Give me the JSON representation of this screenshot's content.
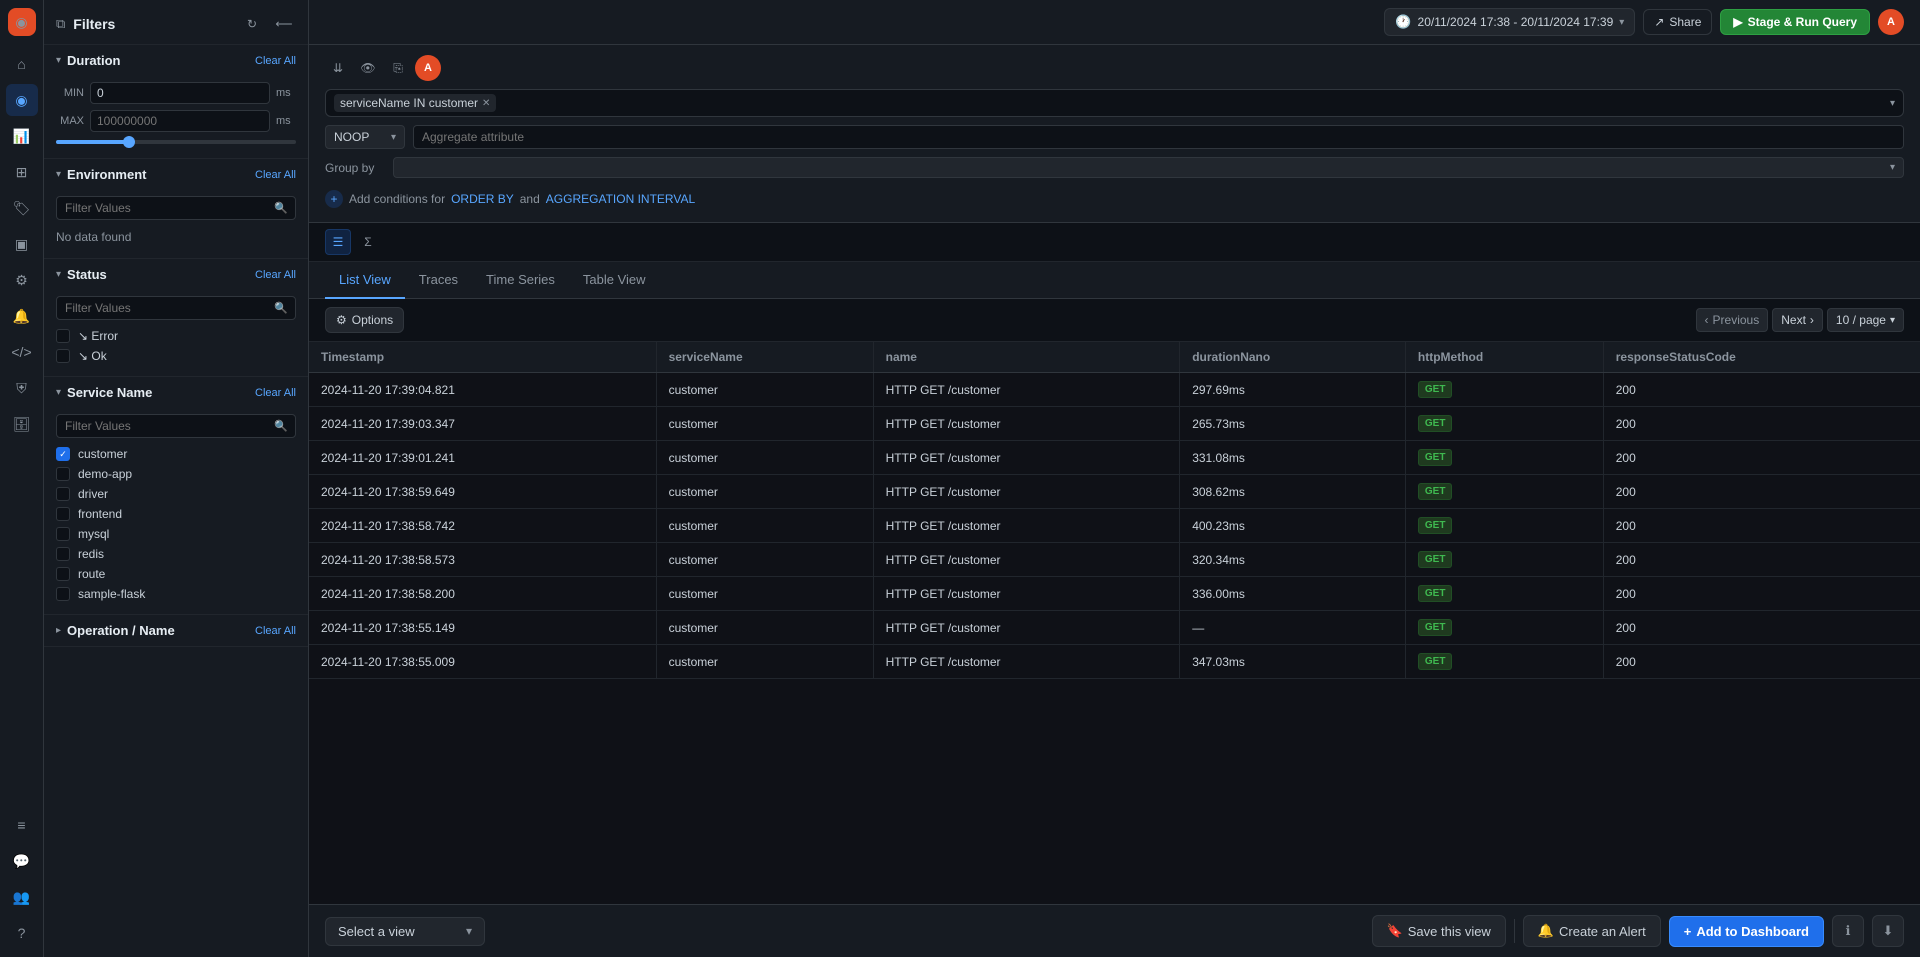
{
  "brand": {
    "icon": "◉",
    "initial": "A"
  },
  "nav": {
    "items": [
      {
        "name": "home",
        "icon": "⌂",
        "active": false
      },
      {
        "name": "activity",
        "icon": "◎",
        "active": false
      },
      {
        "name": "bar-chart",
        "icon": "▦",
        "active": false
      },
      {
        "name": "layers",
        "icon": "⊞",
        "active": false
      },
      {
        "name": "tag",
        "icon": "⊕",
        "active": false
      },
      {
        "name": "grid",
        "icon": "▣",
        "active": false
      },
      {
        "name": "settings-gear",
        "icon": "⚙",
        "active": false
      },
      {
        "name": "bell",
        "icon": "🔔",
        "active": false
      },
      {
        "name": "code",
        "icon": "⟨⟩",
        "active": false
      },
      {
        "name": "shield",
        "icon": "⛨",
        "active": false
      },
      {
        "name": "database",
        "icon": "▦",
        "active": false
      },
      {
        "name": "sliders",
        "icon": "≡",
        "active": false
      },
      {
        "name": "chat",
        "icon": "💬",
        "active": false
      },
      {
        "name": "users",
        "icon": "👥",
        "active": false
      },
      {
        "name": "help",
        "icon": "?",
        "active": false
      }
    ]
  },
  "topbar": {
    "time_range": "20/11/2024 17:38 - 20/11/2024 17:39",
    "share_label": "Share",
    "run_label": "Stage & Run Query",
    "avatar_initial": "A"
  },
  "filters": {
    "title": "Filters",
    "duration": {
      "title": "Duration",
      "clear_label": "Clear All",
      "min_label": "MIN",
      "min_value": "0",
      "min_unit": "ms",
      "max_label": "MAX",
      "max_value": "100000000",
      "max_unit": "ms"
    },
    "environment": {
      "title": "Environment",
      "clear_label": "Clear All",
      "search_placeholder": "Filter Values",
      "no_data": "No data found"
    },
    "status": {
      "title": "Status",
      "clear_label": "Clear All",
      "search_placeholder": "Filter Values",
      "options": [
        {
          "label": "Error",
          "checked": false
        },
        {
          "label": "Ok",
          "checked": false
        }
      ]
    },
    "service_name": {
      "title": "Service Name",
      "clear_label": "Clear All",
      "search_placeholder": "Filter Values",
      "items": [
        {
          "label": "customer",
          "checked": true
        },
        {
          "label": "demo-app",
          "checked": false
        },
        {
          "label": "driver",
          "checked": false
        },
        {
          "label": "frontend",
          "checked": false
        },
        {
          "label": "mysql",
          "checked": false
        },
        {
          "label": "redis",
          "checked": false
        },
        {
          "label": "route",
          "checked": false
        },
        {
          "label": "sample-flask",
          "checked": false
        }
      ]
    },
    "operation_name": {
      "title": "Operation / Name",
      "clear_label": "Clear All"
    }
  },
  "query": {
    "tag_filter": "serviceName IN customer",
    "noop_label": "NOOP",
    "agg_placeholder": "Aggregate attribute",
    "groupby_label": "Group by",
    "conditions_text": "Add conditions for",
    "order_by_label": "ORDER BY",
    "and_label": "and",
    "aggregation_interval_label": "AGGREGATION INTERVAL"
  },
  "toolbar": {
    "buttons": [
      "collapse",
      "eye",
      "copy",
      "A-accent"
    ]
  },
  "tabs": {
    "items": [
      "List View",
      "Traces",
      "Time Series",
      "Table View"
    ],
    "active": "List View"
  },
  "results": {
    "options_label": "Options",
    "previous_label": "Previous",
    "next_label": "Next",
    "page_label": "10 / page",
    "columns": [
      "Timestamp",
      "serviceName",
      "name",
      "durationNano",
      "httpMethod",
      "responseStatusCode"
    ],
    "rows": [
      {
        "timestamp": "2024-11-20 17:39:04.821",
        "serviceName": "customer",
        "name": "HTTP GET /customer",
        "durationNano": "297.69ms",
        "httpMethod": "GET",
        "responseStatusCode": "200"
      },
      {
        "timestamp": "2024-11-20 17:39:03.347",
        "serviceName": "customer",
        "name": "HTTP GET /customer",
        "durationNano": "265.73ms",
        "httpMethod": "GET",
        "responseStatusCode": "200"
      },
      {
        "timestamp": "2024-11-20 17:39:01.241",
        "serviceName": "customer",
        "name": "HTTP GET /customer",
        "durationNano": "331.08ms",
        "httpMethod": "GET",
        "responseStatusCode": "200"
      },
      {
        "timestamp": "2024-11-20 17:38:59.649",
        "serviceName": "customer",
        "name": "HTTP GET /customer",
        "durationNano": "308.62ms",
        "httpMethod": "GET",
        "responseStatusCode": "200"
      },
      {
        "timestamp": "2024-11-20 17:38:58.742",
        "serviceName": "customer",
        "name": "HTTP GET /customer",
        "durationNano": "400.23ms",
        "httpMethod": "GET",
        "responseStatusCode": "200"
      },
      {
        "timestamp": "2024-11-20 17:38:58.573",
        "serviceName": "customer",
        "name": "HTTP GET /customer",
        "durationNano": "320.34ms",
        "httpMethod": "GET",
        "responseStatusCode": "200"
      },
      {
        "timestamp": "2024-11-20 17:38:58.200",
        "serviceName": "customer",
        "name": "HTTP GET /customer",
        "durationNano": "336.00ms",
        "httpMethod": "GET",
        "responseStatusCode": "200"
      },
      {
        "timestamp": "2024-11-20 17:38:55.149",
        "serviceName": "customer",
        "name": "HTTP GET /customer",
        "durationNano": "—",
        "httpMethod": "GET",
        "responseStatusCode": "200"
      },
      {
        "timestamp": "2024-11-20 17:38:55.009",
        "serviceName": "customer",
        "name": "HTTP GET /customer",
        "durationNano": "347.03ms",
        "httpMethod": "GET",
        "responseStatusCode": "200"
      }
    ]
  },
  "bottom_bar": {
    "select_view_label": "Select a view",
    "select_view_chevron": "▾",
    "save_view_label": "Save this view",
    "create_alert_label": "Create an Alert",
    "add_dashboard_label": "Add to Dashboard"
  }
}
